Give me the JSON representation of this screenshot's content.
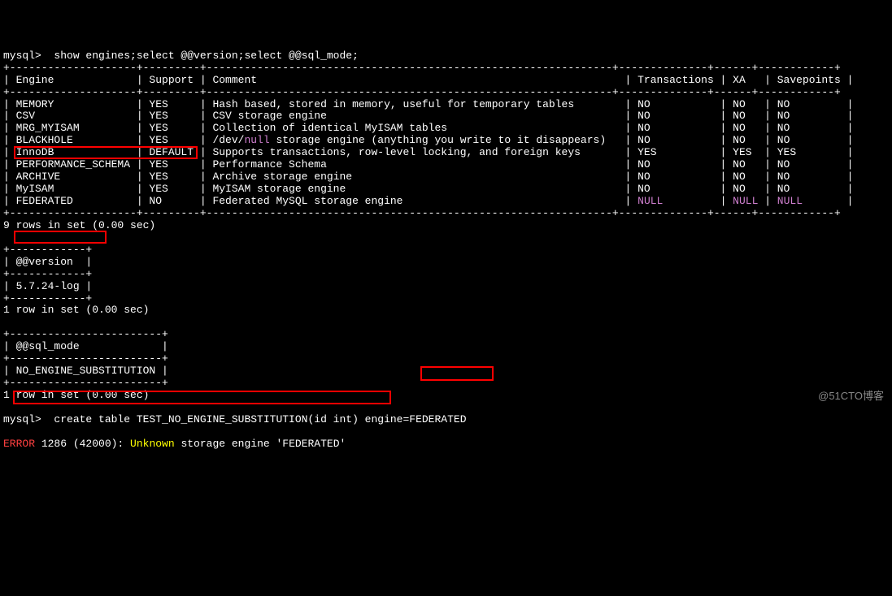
{
  "prompt": "mysql>",
  "cmd1": "show engines;select @@version;select @@sql_mode;",
  "sep_engines": "+--------------------+---------+----------------------------------------------------------------+--------------+------+------------+",
  "hdr": {
    "engine": "Engine",
    "support": "Support",
    "comment": "Comment",
    "tx": "Transactions",
    "xa": "XA",
    "sp": "Savepoints"
  },
  "engines": [
    {
      "name": "MEMORY",
      "support": "YES",
      "comment": "Hash based, stored in memory, useful for temporary tables",
      "tx": "NO",
      "xa": "NO",
      "sp": "NO"
    },
    {
      "name": "CSV",
      "support": "YES",
      "comment": "CSV storage engine",
      "tx": "NO",
      "xa": "NO",
      "sp": "NO"
    },
    {
      "name": "MRG_MYISAM",
      "support": "YES",
      "comment": "Collection of identical MyISAM tables",
      "tx": "NO",
      "xa": "NO",
      "sp": "NO"
    },
    {
      "name": "BLACKHOLE",
      "support": "YES",
      "comment": "/dev/null storage engine (anything you write to it disappears)",
      "tx": "NO",
      "xa": "NO",
      "sp": "NO",
      "null_word": "null"
    },
    {
      "name": "InnoDB",
      "support": "DEFAULT",
      "comment": "Supports transactions, row-level locking, and foreign keys",
      "tx": "YES",
      "xa": "YES",
      "sp": "YES"
    },
    {
      "name": "PERFORMANCE_SCHEMA",
      "support": "YES",
      "comment": "Performance Schema",
      "tx": "NO",
      "xa": "NO",
      "sp": "NO"
    },
    {
      "name": "ARCHIVE",
      "support": "YES",
      "comment": "Archive storage engine",
      "tx": "NO",
      "xa": "NO",
      "sp": "NO"
    },
    {
      "name": "MyISAM",
      "support": "YES",
      "comment": "MyISAM storage engine",
      "tx": "NO",
      "xa": "NO",
      "sp": "NO"
    },
    {
      "name": "FEDERATED",
      "support": "NO",
      "comment": "Federated MySQL storage engine",
      "tx": "NULL",
      "xa": "NULL",
      "sp": "NULL"
    }
  ],
  "rows_engines": "9 rows in set (0.00 sec)",
  "sep_ver": "+------------+",
  "hdr_ver": "@@version",
  "val_ver": "5.7.24-log",
  "rows_ver": "1 row in set (0.00 sec)",
  "sep_mode": "+------------------------+",
  "hdr_mode": "@@sql_mode",
  "val_mode": "NO_ENGINE_SUBSTITUTION",
  "rows_mode": "1 row in set (0.00 sec)",
  "cmd2": "create table TEST_NO_ENGINE_SUBSTITUTION(id int) engine=FEDERATED",
  "err_label": "ERROR",
  "err_code": " 1286 (42000): ",
  "err_word": "Unknown",
  "err_rest": " storage engine 'FEDERATED'",
  "watermark": "@51CTO博客"
}
